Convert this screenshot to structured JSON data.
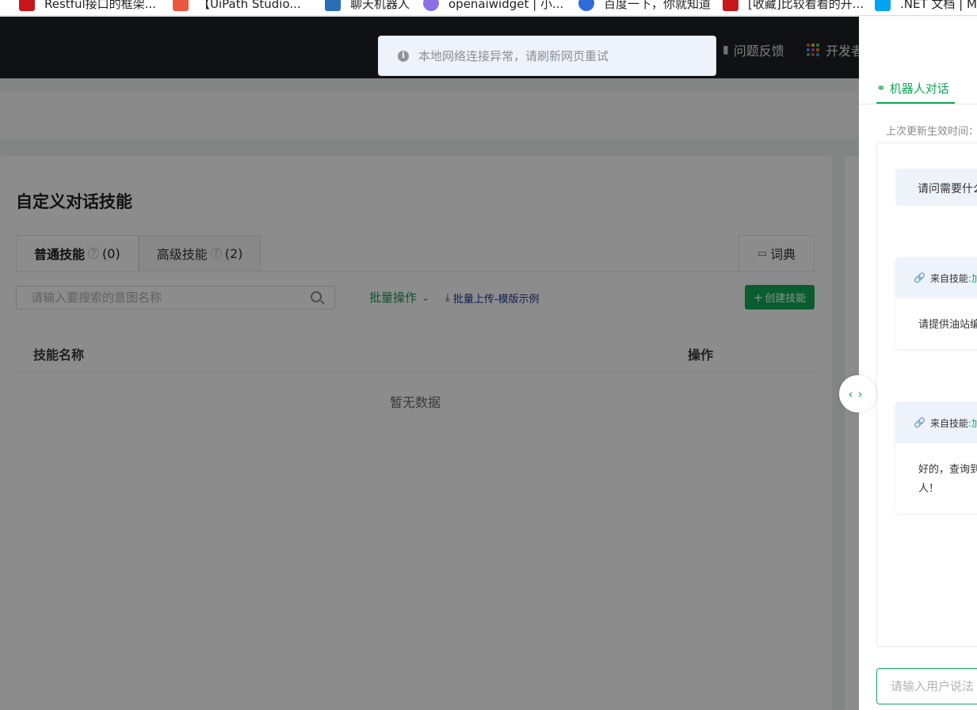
{
  "bookmarks": [
    {
      "label": "Restful接口的框架...",
      "color": "#c8161d"
    },
    {
      "label": "【UiPath Studio...",
      "color": "#e9573e"
    },
    {
      "label": "聊天机器人",
      "color": "#2a6fb5"
    },
    {
      "label": "openaiwidget | 小...",
      "color": "#8c6fe6"
    },
    {
      "label": "百度一下，你就知道",
      "color": "#2f6bd8"
    },
    {
      "label": "[收藏]比较看看的开...",
      "color": "#c8161d"
    },
    {
      "label": ".NET 文档 | Mi",
      "color": "#00a4ef"
    }
  ],
  "nav": {
    "feedback": "问题反馈",
    "developer": "开发者"
  },
  "toast": {
    "message": "本地网络连接异常，请刷新网页重试"
  },
  "main": {
    "title": "自定义对话技能",
    "tabs": [
      {
        "label": "普通技能",
        "count": "(0)"
      },
      {
        "label": "高级技能",
        "count": "(2)"
      }
    ],
    "dictionary_label": "词典",
    "search_placeholder": "请输入要搜索的意图名称",
    "batch_label": "批量操作",
    "upload_label": "批量上传-模版示例",
    "create_label": "创建技能",
    "table": {
      "columns": [
        "技能名称",
        "操作"
      ],
      "empty_text": "暂无数据"
    }
  },
  "drawer": {
    "tab_label": "机器人对话",
    "last_update": "上次更新生效时间：",
    "bubble": "请问需要什么",
    "messages": [
      {
        "source": "来自技能",
        "skill": ":加",
        "body": "请提供油站编"
      },
      {
        "source": "来自技能",
        "skill": ":加",
        "body": "好的，查询到",
        "body2": "人！"
      }
    ],
    "input_placeholder": "请输入用户说法"
  },
  "colors": {
    "accent": "#11a956",
    "nav_bg": "#1e2023"
  }
}
